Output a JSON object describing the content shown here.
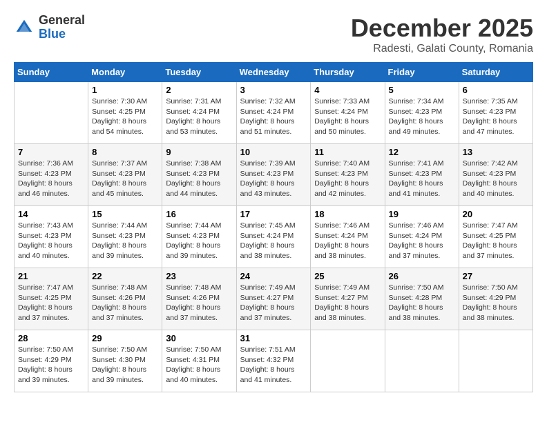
{
  "header": {
    "logo_general": "General",
    "logo_blue": "Blue",
    "month_title": "December 2025",
    "location": "Radesti, Galati County, Romania"
  },
  "days_of_week": [
    "Sunday",
    "Monday",
    "Tuesday",
    "Wednesday",
    "Thursday",
    "Friday",
    "Saturday"
  ],
  "weeks": [
    {
      "days": [
        {
          "num": "",
          "info": ""
        },
        {
          "num": "1",
          "info": "Sunrise: 7:30 AM\nSunset: 4:25 PM\nDaylight: 8 hours\nand 54 minutes."
        },
        {
          "num": "2",
          "info": "Sunrise: 7:31 AM\nSunset: 4:24 PM\nDaylight: 8 hours\nand 53 minutes."
        },
        {
          "num": "3",
          "info": "Sunrise: 7:32 AM\nSunset: 4:24 PM\nDaylight: 8 hours\nand 51 minutes."
        },
        {
          "num": "4",
          "info": "Sunrise: 7:33 AM\nSunset: 4:24 PM\nDaylight: 8 hours\nand 50 minutes."
        },
        {
          "num": "5",
          "info": "Sunrise: 7:34 AM\nSunset: 4:23 PM\nDaylight: 8 hours\nand 49 minutes."
        },
        {
          "num": "6",
          "info": "Sunrise: 7:35 AM\nSunset: 4:23 PM\nDaylight: 8 hours\nand 47 minutes."
        }
      ]
    },
    {
      "days": [
        {
          "num": "7",
          "info": "Sunrise: 7:36 AM\nSunset: 4:23 PM\nDaylight: 8 hours\nand 46 minutes."
        },
        {
          "num": "8",
          "info": "Sunrise: 7:37 AM\nSunset: 4:23 PM\nDaylight: 8 hours\nand 45 minutes."
        },
        {
          "num": "9",
          "info": "Sunrise: 7:38 AM\nSunset: 4:23 PM\nDaylight: 8 hours\nand 44 minutes."
        },
        {
          "num": "10",
          "info": "Sunrise: 7:39 AM\nSunset: 4:23 PM\nDaylight: 8 hours\nand 43 minutes."
        },
        {
          "num": "11",
          "info": "Sunrise: 7:40 AM\nSunset: 4:23 PM\nDaylight: 8 hours\nand 42 minutes."
        },
        {
          "num": "12",
          "info": "Sunrise: 7:41 AM\nSunset: 4:23 PM\nDaylight: 8 hours\nand 41 minutes."
        },
        {
          "num": "13",
          "info": "Sunrise: 7:42 AM\nSunset: 4:23 PM\nDaylight: 8 hours\nand 40 minutes."
        }
      ]
    },
    {
      "days": [
        {
          "num": "14",
          "info": "Sunrise: 7:43 AM\nSunset: 4:23 PM\nDaylight: 8 hours\nand 40 minutes."
        },
        {
          "num": "15",
          "info": "Sunrise: 7:44 AM\nSunset: 4:23 PM\nDaylight: 8 hours\nand 39 minutes."
        },
        {
          "num": "16",
          "info": "Sunrise: 7:44 AM\nSunset: 4:23 PM\nDaylight: 8 hours\nand 39 minutes."
        },
        {
          "num": "17",
          "info": "Sunrise: 7:45 AM\nSunset: 4:24 PM\nDaylight: 8 hours\nand 38 minutes."
        },
        {
          "num": "18",
          "info": "Sunrise: 7:46 AM\nSunset: 4:24 PM\nDaylight: 8 hours\nand 38 minutes."
        },
        {
          "num": "19",
          "info": "Sunrise: 7:46 AM\nSunset: 4:24 PM\nDaylight: 8 hours\nand 37 minutes."
        },
        {
          "num": "20",
          "info": "Sunrise: 7:47 AM\nSunset: 4:25 PM\nDaylight: 8 hours\nand 37 minutes."
        }
      ]
    },
    {
      "days": [
        {
          "num": "21",
          "info": "Sunrise: 7:47 AM\nSunset: 4:25 PM\nDaylight: 8 hours\nand 37 minutes."
        },
        {
          "num": "22",
          "info": "Sunrise: 7:48 AM\nSunset: 4:26 PM\nDaylight: 8 hours\nand 37 minutes."
        },
        {
          "num": "23",
          "info": "Sunrise: 7:48 AM\nSunset: 4:26 PM\nDaylight: 8 hours\nand 37 minutes."
        },
        {
          "num": "24",
          "info": "Sunrise: 7:49 AM\nSunset: 4:27 PM\nDaylight: 8 hours\nand 37 minutes."
        },
        {
          "num": "25",
          "info": "Sunrise: 7:49 AM\nSunset: 4:27 PM\nDaylight: 8 hours\nand 38 minutes."
        },
        {
          "num": "26",
          "info": "Sunrise: 7:50 AM\nSunset: 4:28 PM\nDaylight: 8 hours\nand 38 minutes."
        },
        {
          "num": "27",
          "info": "Sunrise: 7:50 AM\nSunset: 4:29 PM\nDaylight: 8 hours\nand 38 minutes."
        }
      ]
    },
    {
      "days": [
        {
          "num": "28",
          "info": "Sunrise: 7:50 AM\nSunset: 4:29 PM\nDaylight: 8 hours\nand 39 minutes."
        },
        {
          "num": "29",
          "info": "Sunrise: 7:50 AM\nSunset: 4:30 PM\nDaylight: 8 hours\nand 39 minutes."
        },
        {
          "num": "30",
          "info": "Sunrise: 7:50 AM\nSunset: 4:31 PM\nDaylight: 8 hours\nand 40 minutes."
        },
        {
          "num": "31",
          "info": "Sunrise: 7:51 AM\nSunset: 4:32 PM\nDaylight: 8 hours\nand 41 minutes."
        },
        {
          "num": "",
          "info": ""
        },
        {
          "num": "",
          "info": ""
        },
        {
          "num": "",
          "info": ""
        }
      ]
    }
  ]
}
